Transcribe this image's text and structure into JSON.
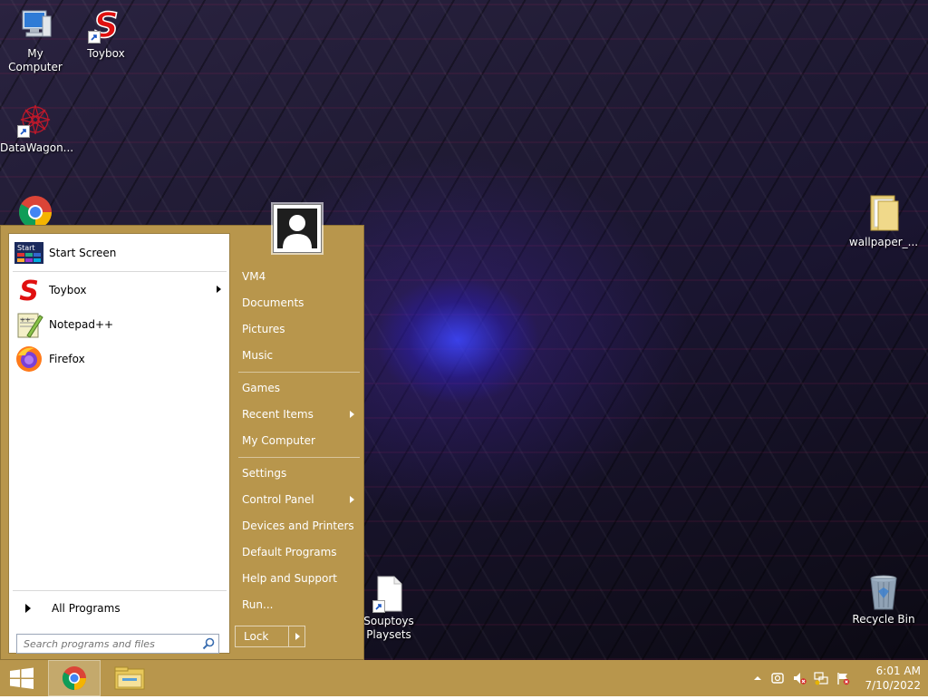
{
  "desktop": {
    "icons": [
      {
        "label": "My Computer"
      },
      {
        "label": "Toybox"
      },
      {
        "label": "DataWagon..."
      },
      {
        "label": "wallpaper_..."
      },
      {
        "label": "Souptoys\nPlaysets"
      },
      {
        "label": "Recycle Bin"
      }
    ]
  },
  "start_menu": {
    "left": {
      "pinned": [
        {
          "label": "Start Screen",
          "icon": "start-screen-icon"
        }
      ],
      "recent": [
        {
          "label": "Toybox",
          "icon": "toybox-icon",
          "has_submenu": true
        },
        {
          "label": "Notepad++",
          "icon": "notepadpp-icon"
        },
        {
          "label": "Firefox",
          "icon": "firefox-icon"
        }
      ],
      "all_programs": "All Programs",
      "search_placeholder": "Search programs and files"
    },
    "right": {
      "items": [
        {
          "label": "VM4"
        },
        {
          "label": "Documents"
        },
        {
          "label": "Pictures"
        },
        {
          "label": "Music"
        },
        {
          "label": "Games"
        },
        {
          "label": "Recent Items",
          "has_submenu": true
        },
        {
          "label": "My Computer"
        },
        {
          "label": "Settings"
        },
        {
          "label": "Control Panel",
          "has_submenu": true
        },
        {
          "label": "Devices and Printers"
        },
        {
          "label": "Default Programs"
        },
        {
          "label": "Help and Support"
        },
        {
          "label": "Run..."
        }
      ],
      "lock_label": "Lock"
    },
    "start_screen_tile_text": "Start"
  },
  "taskbar": {
    "clock": {
      "time": "6:01 AM",
      "date": "7/10/2022"
    },
    "pinned": [
      "start-button",
      "chrome-icon",
      "file-explorer-icon"
    ],
    "tray_icons": [
      "show-hidden-icons-arrow",
      "sync-icon",
      "volume-muted-icon",
      "network-disconnected-icon",
      "action-center-flag-icon"
    ]
  },
  "colors": {
    "accent": "#b8964c"
  }
}
